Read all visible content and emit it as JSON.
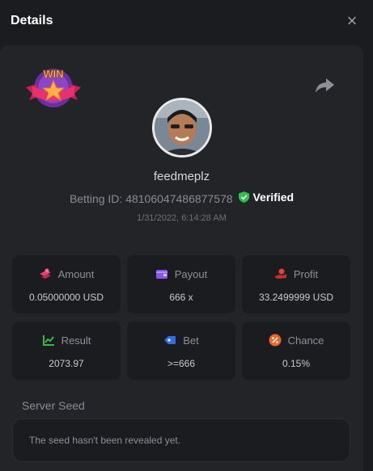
{
  "header": {
    "title": "Details",
    "close_label": "×"
  },
  "badge": {
    "text": "WIN"
  },
  "user": {
    "name": "feedmeplz",
    "betting_id_label": "Betting ID:",
    "betting_id": "481060474868775​78",
    "verified_label": "Verified",
    "date": "1/31/2022, 6:14:28 AM"
  },
  "stats": [
    {
      "label": "Amount",
      "value": "0.05000000 USD",
      "icon": "coins-icon",
      "color": "#e0446a"
    },
    {
      "label": "Payout",
      "value": "666 x",
      "icon": "wallet-icon",
      "color": "#8a56e8"
    },
    {
      "label": "Profit",
      "value": "33.2499999 USD",
      "icon": "hand-coin-icon",
      "color": "#e0443c"
    },
    {
      "label": "Result",
      "value": "2073.97",
      "icon": "chart-icon",
      "color": "#3fb43f"
    },
    {
      "label": "Bet",
      "value": ">=666",
      "icon": "tag-icon",
      "color": "#2f6fe6"
    },
    {
      "label": "Chance",
      "value": "0.15%",
      "icon": "percent-icon",
      "color": "#e8672a"
    }
  ],
  "server_seed": {
    "label": "Server Seed",
    "value": "The seed hasn't been revealed yet."
  }
}
